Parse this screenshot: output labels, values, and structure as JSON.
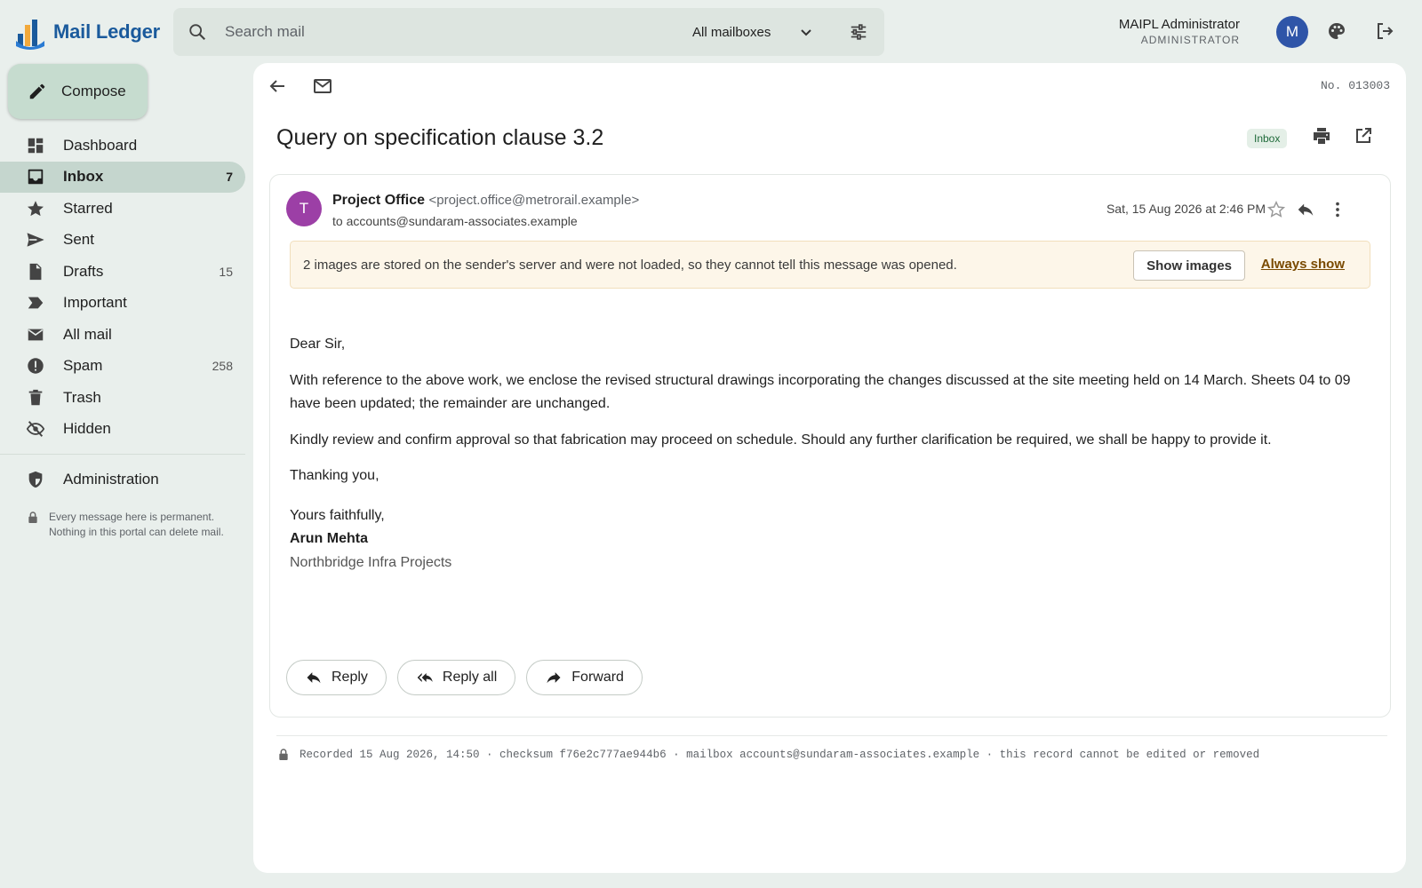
{
  "app": {
    "title": "Mail Ledger"
  },
  "search": {
    "placeholder": "Search mail",
    "mailbox_selected": "All mailboxes"
  },
  "user": {
    "name": "MAIPL Administrator",
    "role": "ADMINISTRATOR",
    "avatar_letter": "M"
  },
  "compose_label": "Compose",
  "sidebar": {
    "items": [
      {
        "label": "Dashboard",
        "count": "",
        "icon": "dashboard-icon"
      },
      {
        "label": "Inbox",
        "count": "7",
        "icon": "inbox-icon"
      },
      {
        "label": "Starred",
        "count": "",
        "icon": "star-icon"
      },
      {
        "label": "Sent",
        "count": "",
        "icon": "send-icon"
      },
      {
        "label": "Drafts",
        "count": "15",
        "icon": "draft-icon"
      },
      {
        "label": "Important",
        "count": "",
        "icon": "label-important-icon"
      },
      {
        "label": "All mail",
        "count": "",
        "icon": "mail-icon"
      },
      {
        "label": "Spam",
        "count": "258",
        "icon": "spam-icon"
      },
      {
        "label": "Trash",
        "count": "",
        "icon": "trash-icon"
      },
      {
        "label": "Hidden",
        "count": "",
        "icon": "hidden-icon"
      }
    ],
    "admin_label": "Administration",
    "note": "Every message here is permanent. Nothing in this portal can delete mail."
  },
  "message": {
    "number": "No. 013003",
    "subject": "Query on specification clause 3.2",
    "folder": "Inbox",
    "sender_initial": "T",
    "sender_name": "Project Office",
    "sender_email": "<project.office@metrorail.example>",
    "to_line": "to accounts@sundaram-associates.example",
    "date": "Sat, 15 Aug 2026 at 2:46 PM",
    "images_warning": "2 images are stored on the sender's server and were not loaded, so they cannot tell this message was opened.",
    "show_images_label": "Show images",
    "always_show_label": "Always show",
    "greeting": "Dear Sir,",
    "para1": "With reference to the above work, we enclose the revised structural drawings incorporating the changes discussed at the site meeting held on 14 March. Sheets 04 to 09 have been updated; the remainder are unchanged.",
    "para2": "Kindly review and confirm approval so that fabrication may proceed on schedule. Should any further clarification be required, we shall be happy to provide it.",
    "thanks": "Thanking you,",
    "closing": "Yours faithfully,",
    "sig_name": "Arun Mehta",
    "sig_org": "Northbridge Infra Projects",
    "reply_label": "Reply",
    "reply_all_label": "Reply all",
    "forward_label": "Forward",
    "audit": "Recorded 15 Aug 2026, 14:50 · checksum f76e2c777ae944b6 · mailbox accounts@sundaram-associates.example · this record cannot be edited or removed"
  },
  "colors": {
    "background": "#e9efec",
    "accent": "#1a5a9c",
    "compose_bg": "#c6dccf",
    "active_nav": "#c5d6ce",
    "avatar_user": "#2f55a8",
    "avatar_sender": "#9c3fa6",
    "warning_bg": "#fdf6e9"
  }
}
